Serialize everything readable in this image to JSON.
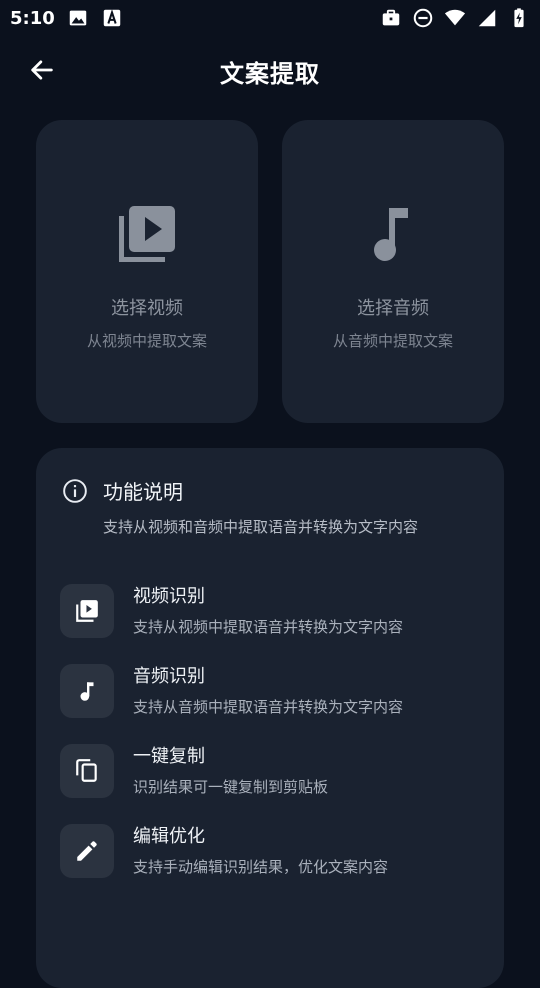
{
  "status_bar": {
    "time": "5:10",
    "left_icons": [
      "image-icon",
      "font-a-icon"
    ],
    "right_icons": [
      "briefcase-icon",
      "do-not-disturb-icon",
      "wifi-icon",
      "signal-icon",
      "battery-charging-icon"
    ]
  },
  "app_bar": {
    "title": "文案提取",
    "back_icon": "arrow-left-icon"
  },
  "pick_cards": [
    {
      "id": "video",
      "title": "选择视频",
      "subtitle": "从视频中提取文案",
      "icon": "video-library-icon"
    },
    {
      "id": "audio",
      "title": "选择音频",
      "subtitle": "从音频中提取文案",
      "icon": "music-note-icon"
    }
  ],
  "info": {
    "icon": "info-icon",
    "title": "功能说明",
    "description": "支持从视频和音频中提取语音并转换为文字内容",
    "features": [
      {
        "title": "视频识别",
        "subtitle": "支持从视频中提取语音并转换为文字内容",
        "icon": "video-library-icon"
      },
      {
        "title": "音频识别",
        "subtitle": "支持从音频中提取语音并转换为文字内容",
        "icon": "music-note-icon"
      },
      {
        "title": "一键复制",
        "subtitle": "识别结果可一键复制到剪贴板",
        "icon": "copy-icon"
      },
      {
        "title": "编辑优化",
        "subtitle": "支持手动编辑识别结果，优化文案内容",
        "icon": "pencil-icon"
      }
    ]
  },
  "colors": {
    "background": "#0b111d",
    "card": "#1a2230",
    "icon_tile": "#2b3340",
    "muted_text": "#8d949f"
  }
}
